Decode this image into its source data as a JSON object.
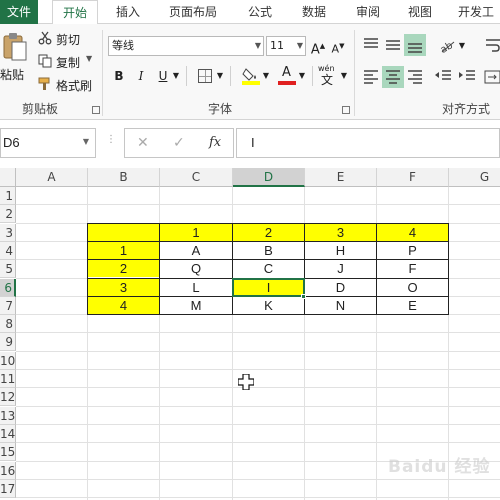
{
  "tabs": {
    "file": "文件",
    "home": "开始",
    "insert": "插入",
    "layout": "页面布局",
    "formulas": "公式",
    "data": "数据",
    "review": "审阅",
    "view": "视图",
    "developer": "开发工"
  },
  "clipboard": {
    "paste": "粘贴",
    "cut": "剪切",
    "copy": "复制",
    "format_painter": "格式刷",
    "group": "剪贴板"
  },
  "font": {
    "name": "等线",
    "size": "11",
    "bold": "B",
    "italic": "I",
    "underline": "U",
    "font_color_letter": "A",
    "phonetic": "wén",
    "group": "字体"
  },
  "alignment": {
    "group": "对齐方式"
  },
  "formula_bar": {
    "name_box": "D6",
    "fx": "fx",
    "cancel": "✕",
    "confirm": "✓",
    "content": "I"
  },
  "columns": [
    "A",
    "B",
    "C",
    "D",
    "E",
    "F",
    "G"
  ],
  "rows": [
    "1",
    "2",
    "3",
    "4",
    "5",
    "6",
    "7",
    "8",
    "9",
    "10",
    "11",
    "12",
    "13",
    "14",
    "15",
    "16",
    "17"
  ],
  "table": {
    "header_row": [
      "",
      "1",
      "2",
      "3",
      "4"
    ],
    "rows": [
      [
        "1",
        "A",
        "B",
        "H",
        "P"
      ],
      [
        "2",
        "Q",
        "C",
        "J",
        "F"
      ],
      [
        "3",
        "L",
        "I",
        "D",
        "O"
      ],
      [
        "4",
        "M",
        "K",
        "N",
        "E"
      ]
    ]
  },
  "colors": {
    "accent": "#217346",
    "highlight": "#ffff00"
  },
  "selected_cell": "D6",
  "watermark": "Baidu 经验"
}
